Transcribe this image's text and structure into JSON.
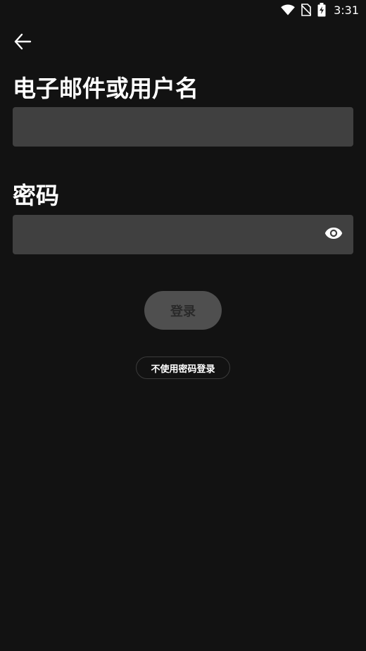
{
  "status_bar": {
    "time": "3:31",
    "icons": [
      "wifi-icon",
      "no-sim-icon",
      "battery-charging-icon"
    ]
  },
  "nav": {
    "back_icon": "arrow-left-icon"
  },
  "form": {
    "email_label": "电子邮件或用户名",
    "email_value": "",
    "password_label": "密码",
    "password_value": "",
    "password_toggle_icon": "eye-icon"
  },
  "actions": {
    "login_label": "登录",
    "login_without_password_label": "不使用密码登录"
  },
  "colors": {
    "background": "#121212",
    "field_background": "#404040",
    "button_disabled": "#4f4f4f",
    "text": "#ffffff"
  }
}
